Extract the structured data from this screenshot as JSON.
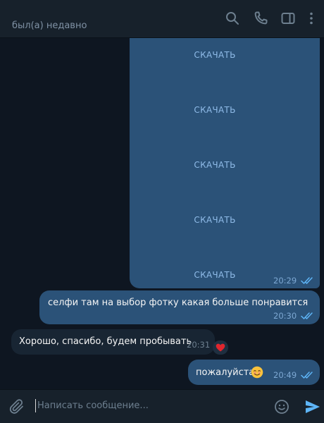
{
  "header": {
    "status": "был(а) недавно",
    "icons": [
      "search-icon",
      "phone-icon",
      "sidebar-toggle-icon",
      "more-icon"
    ]
  },
  "media_message": {
    "download_labels": [
      "СКАЧАТЬ",
      "СКАЧАТЬ",
      "СКАЧАТЬ",
      "СКАЧАТЬ",
      "СКАЧАТЬ"
    ],
    "time": "20:29",
    "read": true
  },
  "messages": [
    {
      "direction": "out",
      "text": "селфи там на выбор фотку какая больше понравится",
      "time": "20:30",
      "read": true
    },
    {
      "direction": "in",
      "text": "Хорошо, спасибо, будем пробывать",
      "time": "20:31",
      "reaction": "heart"
    },
    {
      "direction": "out",
      "text": "пожалуйста)",
      "emoji": "smiling-face",
      "time": "20:49",
      "read": true
    }
  ],
  "input": {
    "placeholder": "Написать сообщение...",
    "icons": [
      "attach-icon",
      "emoji-icon",
      "send-icon"
    ]
  },
  "colors": {
    "background": "#0e1621",
    "header": "#17212b",
    "outgoing_bubble": "#2b5278",
    "incoming_bubble": "#182533",
    "accent": "#5eb5f7",
    "download": "#8fbbe8",
    "reaction_heart": "#e0262e"
  }
}
